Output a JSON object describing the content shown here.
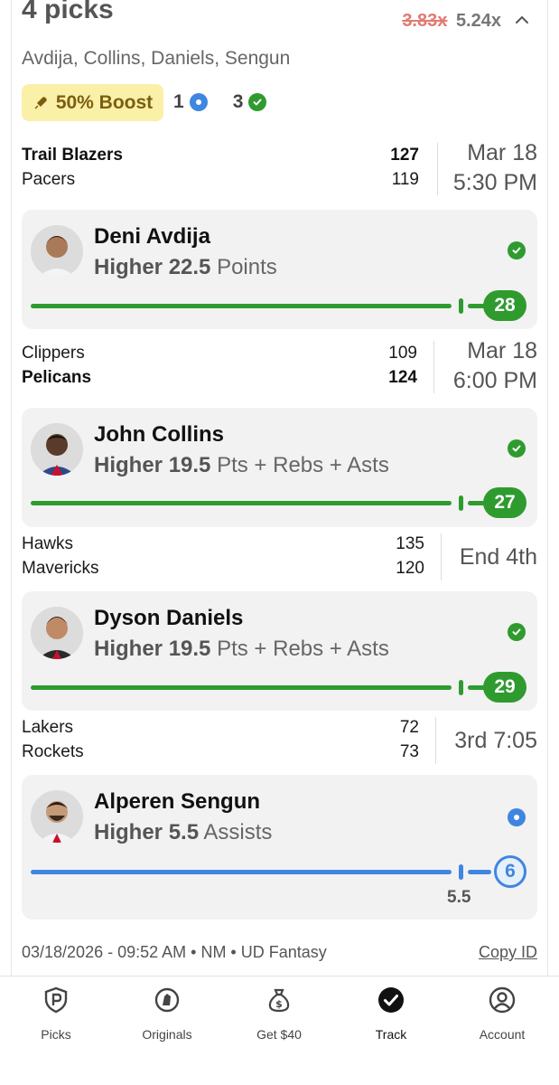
{
  "entry": {
    "title": "4 picks",
    "multiplier_old": "3.83x",
    "multiplier_new": "5.24x",
    "players_summary": "Avdija, Collins, Daniels, Sengun",
    "boost_label": "50% Boost",
    "pending_count": "1",
    "won_count": "3"
  },
  "games": [
    {
      "team1": "Trail Blazers",
      "score1": "127",
      "team2": "Pacers",
      "score2": "119",
      "time_line1": "Mar 18",
      "time_line2": "5:30 PM"
    },
    {
      "team1": "Clippers",
      "score1": "109",
      "team2": "Pelicans",
      "score2": "124",
      "time_line1": "Mar 18",
      "time_line2": "6:00 PM"
    },
    {
      "team1": "Hawks",
      "score1": "135",
      "team2": "Mavericks",
      "score2": "120",
      "time_line1": "End 4th",
      "time_line2": ""
    },
    {
      "team1": "Lakers",
      "score1": "72",
      "team2": "Rockets",
      "score2": "73",
      "time_line1": "3rd 7:05",
      "time_line2": ""
    }
  ],
  "picks": [
    {
      "player": "Deni Avdija",
      "direction": "Higher",
      "line": "22.5",
      "stat": "Points",
      "actual": "28",
      "status": "won",
      "color": "#2f9b2f"
    },
    {
      "player": "John Collins",
      "direction": "Higher",
      "line": "19.5",
      "stat": "Pts + Rebs + Asts",
      "actual": "27",
      "status": "won",
      "color": "#2f9b2f"
    },
    {
      "player": "Dyson Daniels",
      "direction": "Higher",
      "line": "19.5",
      "stat": "Pts + Rebs + Asts",
      "actual": "29",
      "status": "won",
      "color": "#2f9b2f"
    },
    {
      "player": "Alperen Sengun",
      "direction": "Higher",
      "line": "5.5",
      "stat": "Assists",
      "actual": "6",
      "status": "pending",
      "line_label": "5.5",
      "color": "#3f86e0"
    }
  ],
  "footer": {
    "meta": "03/18/2026 - 09:52 AM • NM • UD Fantasy",
    "copy_id": "Copy ID"
  },
  "tabs": [
    {
      "label": "Picks",
      "icon": "picks-icon"
    },
    {
      "label": "Originals",
      "icon": "originals-icon"
    },
    {
      "label": "Get $40",
      "icon": "money-bag-icon"
    },
    {
      "label": "Track",
      "icon": "track-check-icon",
      "active": true
    },
    {
      "label": "Account",
      "icon": "account-icon"
    }
  ]
}
